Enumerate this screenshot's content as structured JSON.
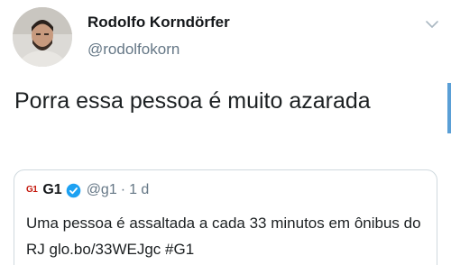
{
  "tweet": {
    "author_name": "Rodolfo Korndörfer",
    "author_handle": "@rodolfokorn",
    "text": "Porra essa pessoa é muito azarada"
  },
  "quoted_tweet": {
    "logo_text": "G1",
    "name": "G1",
    "handle": "@g1",
    "separator": "·",
    "time": "1 d",
    "text": "Uma pessoa é assaltada a cada 33 minutos em ônibus do RJ glo.bo/33WEJgc #G1"
  },
  "icons": {
    "menu": "chevron-down-icon",
    "verified": "verified-badge-icon"
  },
  "colors": {
    "secondary_text": "#657786",
    "verified_blue": "#1da1f2",
    "g1_red": "#c4170c"
  }
}
